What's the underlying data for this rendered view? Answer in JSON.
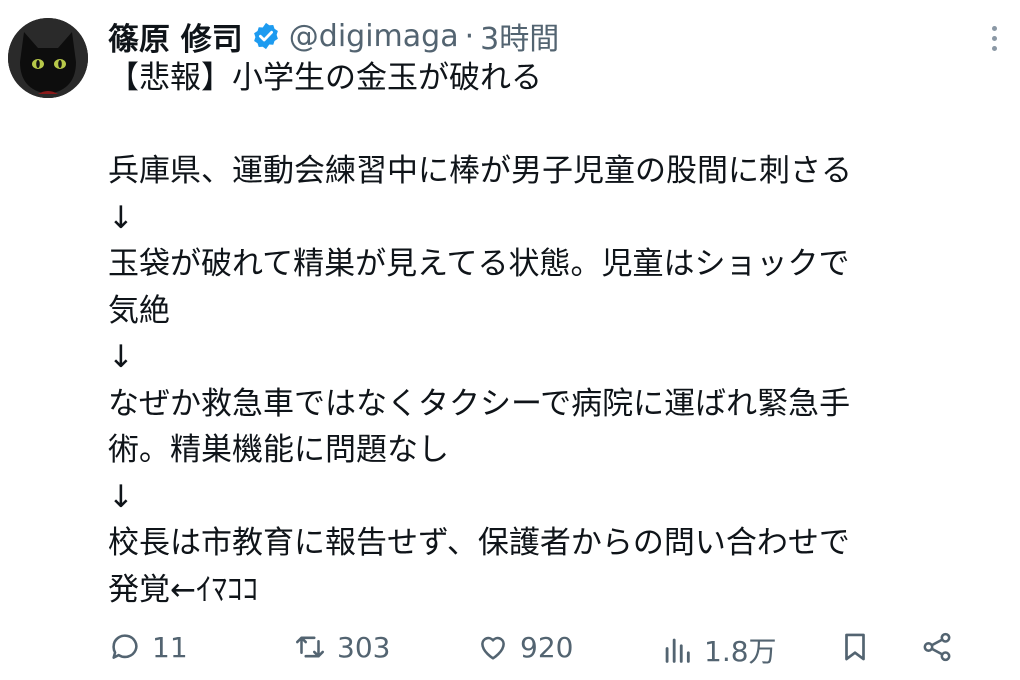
{
  "author": {
    "display_name": "篠原 修司",
    "handle": "@digimaga",
    "separator": "·",
    "time": "3時間",
    "verified": true
  },
  "tweet_lines": [
    "【悲報】小学生の金玉が破れる",
    "",
    "兵庫県、運動会練習中に棒が男子児童の股間に刺さる",
    "↓",
    "玉袋が破れて精巣が見えてる状態。児童はショックで",
    "気絶",
    "↓",
    "なぜか救急車ではなくタクシーで病院に運ばれ緊急手",
    "術。精巣機能に問題なし",
    "↓",
    "校長は市教育に報告せず、保護者からの問い合わせで",
    "発覚←ｲﾏｺｺ"
  ],
  "actions": {
    "replies": "11",
    "retweets": "303",
    "likes": "920",
    "views": "1.8万"
  },
  "colors": {
    "text": "#0f1419",
    "secondary": "#536471",
    "verified_badge": "#1d9bf0"
  },
  "icons": [
    "avatar-cat",
    "verified-badge-icon",
    "more-icon",
    "reply-icon",
    "retweet-icon",
    "like-icon",
    "views-icon",
    "bookmark-icon",
    "share-icon"
  ]
}
